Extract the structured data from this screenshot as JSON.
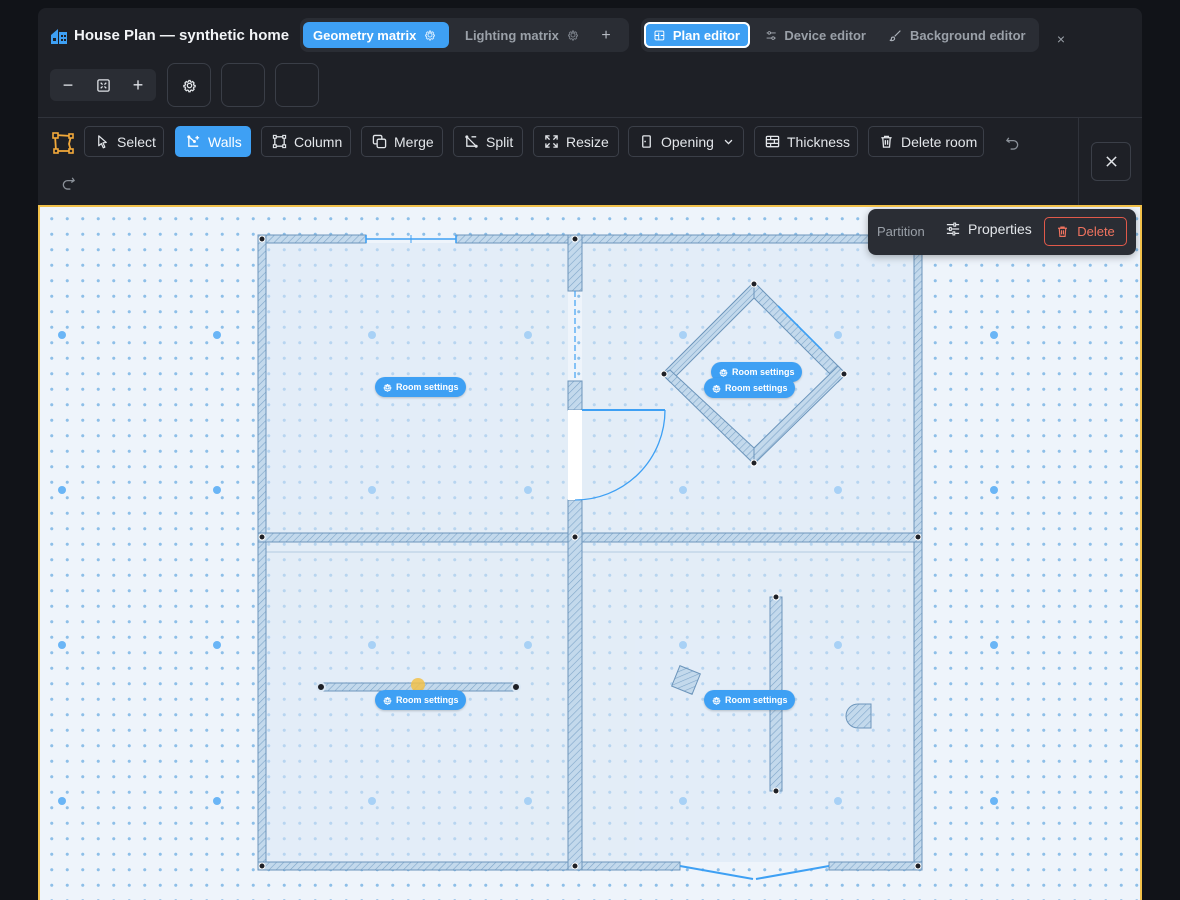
{
  "header": {
    "title": "House Plan — synthetic home",
    "tabs": [
      {
        "label": "Geometry matrix",
        "active": true
      },
      {
        "label": "Lighting matrix",
        "active": false
      }
    ],
    "add_tab_icon": "plus-icon",
    "modes": [
      {
        "label": "Plan editor",
        "icon": "floorplan-icon",
        "active": true
      },
      {
        "label": "Device editor",
        "icon": "sliders-icon",
        "active": false
      },
      {
        "label": "Background editor",
        "icon": "brush-icon",
        "active": false
      }
    ],
    "close_icon": "close-icon"
  },
  "zoom": {
    "minus": "−",
    "plus": "+",
    "fit_icon": "fit-view-icon",
    "settings_icon": "gear-icon"
  },
  "toolbar": {
    "tools": [
      {
        "label": "Select",
        "icon": "cursor-icon",
        "active": false
      },
      {
        "label": "Walls",
        "icon": "walls-icon",
        "active": true
      },
      {
        "label": "Column",
        "icon": "column-icon",
        "active": false
      },
      {
        "label": "Merge",
        "icon": "merge-icon",
        "active": false
      },
      {
        "label": "Split",
        "icon": "split-icon",
        "active": false
      },
      {
        "label": "Resize",
        "icon": "resize-icon",
        "active": false
      },
      {
        "label": "Opening",
        "icon": "door-icon",
        "active": false
      },
      {
        "label": "Thickness",
        "icon": "brick-icon",
        "active": false
      },
      {
        "label": "Delete room",
        "icon": "trash-icon",
        "active": false
      }
    ],
    "undo_icon": "undo-icon",
    "redo_icon": "redo-icon"
  },
  "popup": {
    "label": "Partition",
    "properties_label": "Properties",
    "delete_label": "Delete"
  },
  "rooms": {
    "button_label": "Room settings",
    "count": 5
  },
  "colors": {
    "accent": "#3ea0f4",
    "canvas_border": "#f2c14a",
    "danger": "#e0594a",
    "wall_fill": "#c3d9ec",
    "wall_stroke": "#6c95bb"
  }
}
